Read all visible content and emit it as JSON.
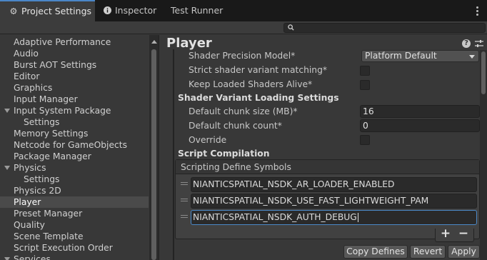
{
  "tabs": [
    {
      "label": "Project Settings",
      "icon": "gear-icon",
      "active": true
    },
    {
      "label": "Inspector",
      "icon": "info-icon",
      "active": false
    },
    {
      "label": "Test Runner",
      "icon": "",
      "active": false
    }
  ],
  "search": {
    "placeholder": "",
    "value": "",
    "icon": "search-icon"
  },
  "sidebar": {
    "items": [
      {
        "label": "Adaptive Performance"
      },
      {
        "label": "Audio"
      },
      {
        "label": "Burst AOT Settings"
      },
      {
        "label": "Editor"
      },
      {
        "label": "Graphics"
      },
      {
        "label": "Input Manager"
      },
      {
        "label": "Input System Package",
        "expanded": true
      },
      {
        "label": "Settings",
        "child": true
      },
      {
        "label": "Memory Settings"
      },
      {
        "label": "Netcode for GameObjects"
      },
      {
        "label": "Package Manager"
      },
      {
        "label": "Physics",
        "expanded": true
      },
      {
        "label": "Settings",
        "child": true
      },
      {
        "label": "Physics 2D"
      },
      {
        "label": "Player",
        "selected": true
      },
      {
        "label": "Preset Manager"
      },
      {
        "label": "Quality"
      },
      {
        "label": "Scene Template"
      },
      {
        "label": "Script Execution Order"
      },
      {
        "label": "Services",
        "expanded": true
      }
    ]
  },
  "main": {
    "title": "Player",
    "help_icon": "help-icon",
    "settings_icon": "sliders-icon",
    "shader_precision_model": {
      "label": "Shader Precision Model*",
      "value": "Platform Default"
    },
    "strict_variant_matching": {
      "label": "Strict shader variant matching*",
      "checked": false
    },
    "keep_loaded_shaders": {
      "label": "Keep Loaded Shaders Alive*",
      "checked": false
    },
    "shader_variant_loading_header": "Shader Variant Loading Settings",
    "default_chunk_size": {
      "label": "Default chunk size (MB)*",
      "value": "16"
    },
    "default_chunk_count": {
      "label": "Default chunk count*",
      "value": "0"
    },
    "override": {
      "label": "Override",
      "checked": false
    },
    "script_compilation_header": "Script Compilation",
    "define_symbols": {
      "label": "Scripting Define Symbols",
      "items": [
        "NIANTICSPATIAL_NSDK_AR_LOADER_ENABLED",
        "NIANTICSPATIAL_NSDK_USE_FAST_LIGHTWEIGHT_PAM",
        "NIANTICSPATIAL_NSDK_AUTH_DEBUG"
      ],
      "add_label": "+",
      "remove_label": "−"
    },
    "buttons": {
      "copy": "Copy Defines",
      "revert": "Revert",
      "apply": "Apply"
    }
  },
  "colors": {
    "accent": "#4b89c8",
    "selected_row": "#4a4a4a",
    "tab_bg": "#191919",
    "panel_bg": "#383838"
  }
}
